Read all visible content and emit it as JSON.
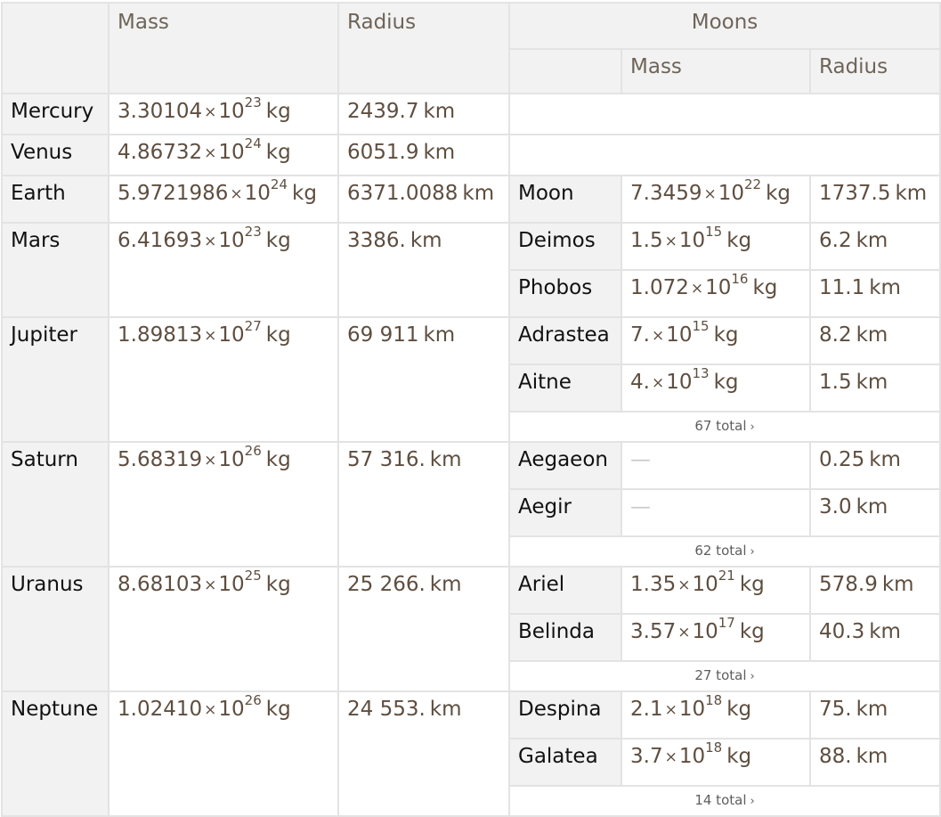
{
  "header": {
    "mass": "Mass",
    "radius": "Radius",
    "moons": "Moons",
    "moon_mass": "Mass",
    "moon_radius": "Radius"
  },
  "units": {
    "kg": "kg",
    "km": "km",
    "times": "×",
    "ten": "10"
  },
  "planets": [
    {
      "name": "Mercury",
      "mass_mantissa": "3.30104",
      "mass_exp": "23",
      "radius": "2439.7"
    },
    {
      "name": "Venus",
      "mass_mantissa": "4.86732",
      "mass_exp": "24",
      "radius": "6051.9"
    },
    {
      "name": "Earth",
      "mass_mantissa": "5.9721986",
      "mass_exp": "24",
      "radius": "6371.0088",
      "moons": [
        {
          "name": "Moon",
          "mass_mantissa": "7.3459",
          "mass_exp": "22",
          "radius": "1737.5"
        }
      ]
    },
    {
      "name": "Mars",
      "mass_mantissa": "6.41693",
      "mass_exp": "23",
      "radius": "3386.",
      "moons": [
        {
          "name": "Deimos",
          "mass_mantissa": "1.5",
          "mass_exp": "15",
          "radius": "6.2"
        },
        {
          "name": "Phobos",
          "mass_mantissa": "1.072",
          "mass_exp": "16",
          "radius": "11.1"
        }
      ]
    },
    {
      "name": "Jupiter",
      "mass_mantissa": "1.89813",
      "mass_exp": "27",
      "radius": "69 911",
      "moons": [
        {
          "name": "Adrastea",
          "mass_mantissa": "7.",
          "mass_exp": "15",
          "radius": "8.2"
        },
        {
          "name": "Aitne",
          "mass_mantissa": "4.",
          "mass_exp": "13",
          "radius": "1.5"
        }
      ],
      "total": "67 total"
    },
    {
      "name": "Saturn",
      "mass_mantissa": "5.68319",
      "mass_exp": "26",
      "radius": "57 316.",
      "moons": [
        {
          "name": "Aegaeon",
          "mass_missing": "—",
          "radius": "0.25"
        },
        {
          "name": "Aegir",
          "mass_missing": "—",
          "radius": "3.0"
        }
      ],
      "total": "62 total"
    },
    {
      "name": "Uranus",
      "mass_mantissa": "8.68103",
      "mass_exp": "25",
      "radius": "25 266.",
      "moons": [
        {
          "name": "Ariel",
          "mass_mantissa": "1.35",
          "mass_exp": "21",
          "radius": "578.9"
        },
        {
          "name": "Belinda",
          "mass_mantissa": "3.57",
          "mass_exp": "17",
          "radius": "40.3"
        }
      ],
      "total": "27 total"
    },
    {
      "name": "Neptune",
      "mass_mantissa": "1.02410",
      "mass_exp": "26",
      "radius": "24 553.",
      "moons": [
        {
          "name": "Despina",
          "mass_mantissa": "2.1",
          "mass_exp": "18",
          "radius": "75."
        },
        {
          "name": "Galatea",
          "mass_mantissa": "3.7",
          "mass_exp": "18",
          "radius": "88."
        }
      ],
      "total": "14 total"
    }
  ]
}
